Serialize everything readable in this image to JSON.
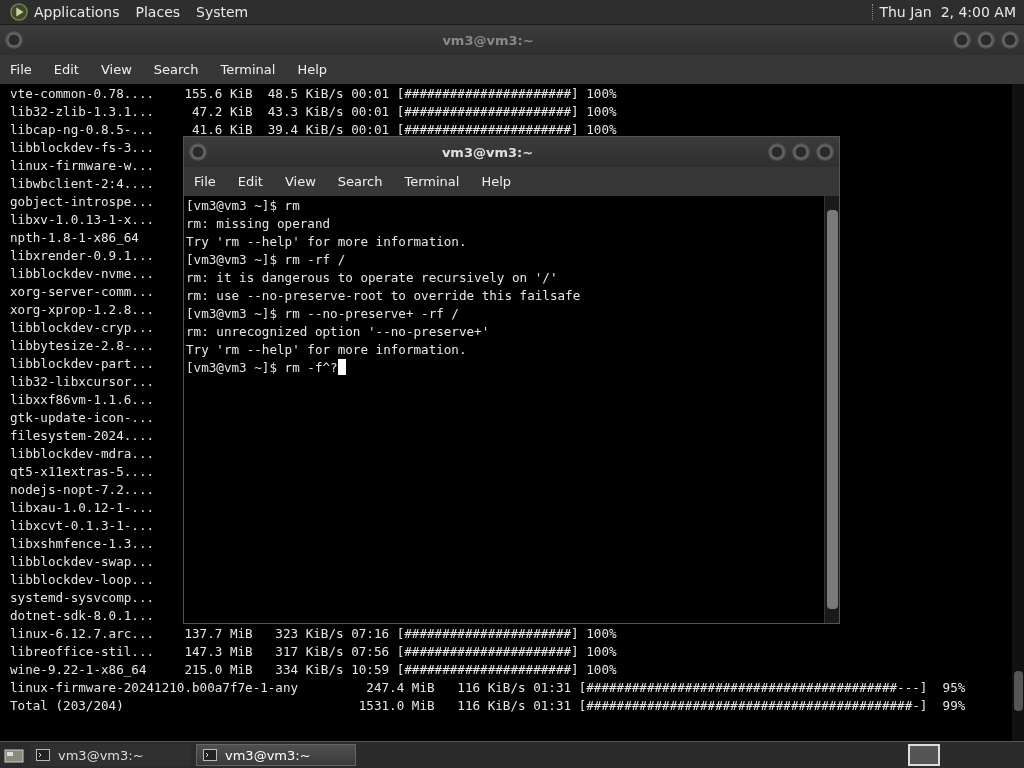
{
  "top_panel": {
    "menus": [
      "Applications",
      "Places",
      "System"
    ],
    "clock": "Thu Jan  2, 4:00 AM"
  },
  "back_window": {
    "title": "vm3@vm3:~",
    "menu": [
      "File",
      "Edit",
      "View",
      "Search",
      "Terminal",
      "Help"
    ],
    "lines": [
      "vte-common-0.78....    155.6 KiB  48.5 KiB/s 00:01 [######################] 100%",
      "lib32-zlib-1.3.1...     47.2 KiB  43.3 KiB/s 00:01 [######################] 100%",
      "libcap-ng-0.8.5-...     41.6 KiB  39.4 KiB/s 00:01 [######################] 100%",
      "libblockdev-fs-3...",
      "linux-firmware-w...",
      "libwbclient-2:4....",
      "gobject-introspe...",
      "libxv-1.0.13-1-x...",
      "npth-1.8-1-x86_64",
      "libxrender-0.9.1...",
      "libblockdev-nvme...",
      "xorg-server-comm...",
      "xorg-xprop-1.2.8...",
      "libblockdev-cryp...",
      "libbytesize-2.8-...",
      "libblockdev-part...",
      "lib32-libxcursor...",
      "libxxf86vm-1.1.6...",
      "gtk-update-icon-...",
      "filesystem-2024....",
      "libblockdev-mdra...",
      "qt5-x11extras-5....",
      "nodejs-nopt-7.2....",
      "libxau-1.0.12-1-...",
      "libxcvt-0.1.3-1-...",
      "libxshmfence-1.3...",
      "libblockdev-swap...",
      "libblockdev-loop...",
      "systemd-sysvcomp...",
      "dotnet-sdk-8.0.1...",
      "linux-6.12.7.arc...    137.7 MiB   323 KiB/s 07:16 [######################] 100%",
      "libreoffice-stil...    147.3 MiB   317 KiB/s 07:56 [######################] 100%",
      "wine-9.22-1-x86_64     215.0 MiB   334 KiB/s 10:59 [######################] 100%",
      "linux-firmware-20241210.b00a7f7e-1-any         247.4 MiB   116 KiB/s 01:31 [#########################################---]  95%",
      "Total (203/204)                               1531.0 MiB   116 KiB/s 01:31 [###########################################-]  99%"
    ]
  },
  "front_window": {
    "title": "vm3@vm3:~",
    "menu": [
      "File",
      "Edit",
      "View",
      "Search",
      "Terminal",
      "Help"
    ],
    "lines": [
      "[vm3@vm3 ~]$ rm",
      "rm: missing operand",
      "Try 'rm --help' for more information.",
      "[vm3@vm3 ~]$ rm -rf /",
      "rm: it is dangerous to operate recursively on '/'",
      "rm: use --no-preserve-root to override this failsafe",
      "[vm3@vm3 ~]$ rm --no-preserve+ -rf /",
      "rm: unrecognized option '--no-preserve+'",
      "Try 'rm --help' for more information.",
      "[vm3@vm3 ~]$ rm -f^?"
    ]
  },
  "taskbar": {
    "items": [
      {
        "label": "vm3@vm3:~",
        "selected": false
      },
      {
        "label": "vm3@vm3:~",
        "selected": true
      }
    ]
  }
}
